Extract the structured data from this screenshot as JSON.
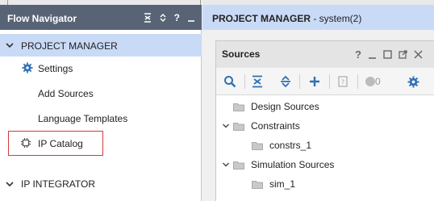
{
  "flow_navigator": {
    "title": "Flow Navigator",
    "header_icons": [
      "collapse-all-icon",
      "expand-all-icon",
      "help-icon",
      "minimize-icon"
    ],
    "help_label": "?",
    "sections": [
      {
        "label": "PROJECT MANAGER",
        "expanded": true,
        "items": [
          {
            "label": "Settings",
            "icon": "gear-icon"
          },
          {
            "label": "Add Sources"
          },
          {
            "label": "Language Templates"
          },
          {
            "label": "IP Catalog",
            "icon": "ip-chip-icon",
            "highlighted": true
          }
        ]
      },
      {
        "label": "IP INTEGRATOR",
        "expanded": true
      }
    ]
  },
  "project_header": {
    "title_bold": "PROJECT MANAGER",
    "title_rest": " - system(2)"
  },
  "sources_panel": {
    "title": "Sources",
    "help_label": "?",
    "header_icons": [
      "help-icon",
      "minimize-icon",
      "maximize-icon",
      "float-icon",
      "close-icon"
    ],
    "toolbar": {
      "buttons": [
        "search-icon",
        "collapse-all-icon",
        "expand-all-icon",
        "add-icon",
        "unknown-file-icon"
      ],
      "status_count": "0",
      "settings_icon": "gear-icon"
    },
    "tree": [
      {
        "label": "Design Sources",
        "expandable": false,
        "level": 0
      },
      {
        "label": "Constraints",
        "expandable": true,
        "expanded": true,
        "level": 0
      },
      {
        "label": "constrs_1",
        "level": 1
      },
      {
        "label": "Simulation Sources",
        "expandable": true,
        "expanded": true,
        "level": 0
      },
      {
        "label": "sim_1",
        "level": 1
      }
    ]
  },
  "colors": {
    "nav_header_bg": "#586476",
    "section_highlight_bg": "#c9daf6",
    "highlight_border": "#d63a3a",
    "accent_icon": "#2f6fb5"
  }
}
